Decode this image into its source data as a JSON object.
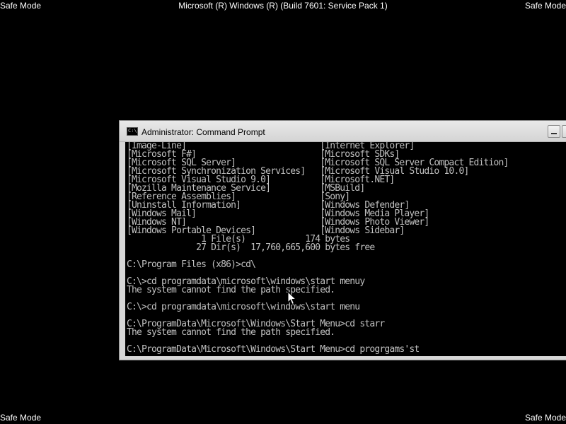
{
  "screen": {
    "top_left_label": "Safe Mode",
    "top_right_label": "Safe Mode",
    "bottom_left_label": "Safe Mode",
    "bottom_right_label": "Safe Mode",
    "os_banner": "Microsoft (R) Windows (R) (Build 7601: Service Pack 1)"
  },
  "window": {
    "title": "Administrator:  Command Prompt",
    "icon": "cmd-icon",
    "background_color": "#000000",
    "text_color": "#c0c0c0"
  },
  "console": {
    "lines": [
      "[Image-Line]                           [Internet Explorer]",
      "[Microsoft F#]                         [Microsoft SDKs]",
      "[Microsoft SQL Server]                 [Microsoft SQL Server Compact Edition]",
      "[Microsoft Synchronization Services]   [Microsoft Visual Studio 10.0]",
      "[Microsoft Visual Studio 9.0]          [Microsoft.NET]",
      "[Mozilla Maintenance Service]          [MSBuild]",
      "[Reference Assemblies]                 [Sony]",
      "[Uninstall Information]                [Windows Defender]",
      "[Windows Mail]                         [Windows Media Player]",
      "[Windows NT]                           [Windows Photo Viewer]",
      "[Windows Portable Devices]             [Windows Sidebar]",
      "               1 File(s)            174 bytes",
      "              27 Dir(s)  17,760,665,600 bytes free",
      "",
      "C:\\Program Files (x86)>cd\\",
      "",
      "C:\\>cd programdata\\microsoft\\windows\\start menuy",
      "The system cannot find the path specified.",
      "",
      "C:\\>cd programdata\\microsoft\\windows\\start menu",
      "",
      "C:\\ProgramData\\Microsoft\\Windows\\Start Menu>cd starr",
      "The system cannot find the path specified.",
      "",
      "C:\\ProgramData\\Microsoft\\Windows\\Start Menu>cd progrgams'st"
    ]
  }
}
